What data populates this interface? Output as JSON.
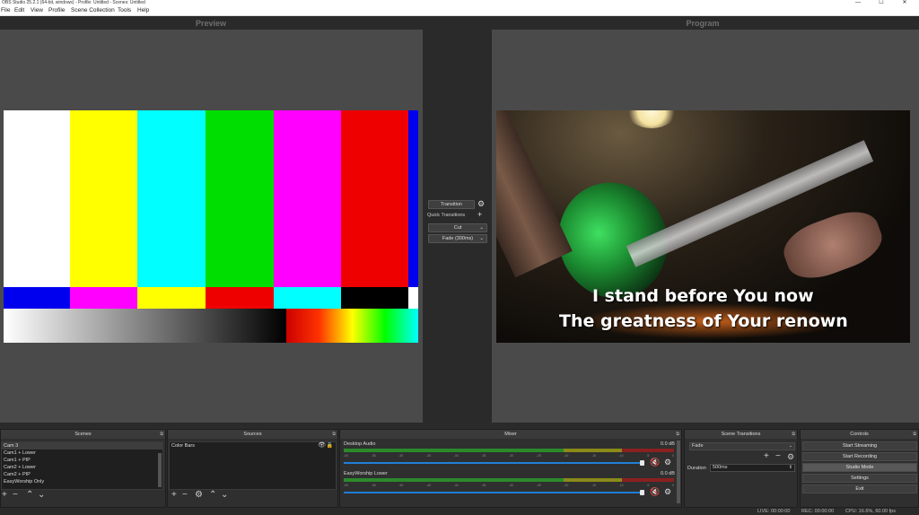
{
  "window": {
    "title": "OBS Studio 25.2.1 (64-bit, windows) - Profile: Untitled - Scenes: Untitled",
    "minimize": "—",
    "maximize": "☐",
    "close": "✕"
  },
  "menu": [
    "File",
    "Edit",
    "View",
    "Profile",
    "Scene Collection",
    "Tools",
    "Help"
  ],
  "preview": {
    "label": "Preview"
  },
  "program": {
    "label": "Program",
    "lyric_line1": "I stand before You now",
    "lyric_line2": "The greatness of Your renown"
  },
  "transition_panel": {
    "transition_button": "Transition",
    "quick_transitions_label": "Quick Transitions",
    "cut_label": "Cut",
    "fade_label": "Fade (300ms)"
  },
  "scenes": {
    "title": "Scenes",
    "items": [
      "Cam 3",
      "Cam1 + Lower",
      "Cam1 + PIP",
      "Cam2 + Lower",
      "Cam2 + PIP",
      "EasyWorship Only"
    ],
    "selected_index": 0
  },
  "sources": {
    "title": "Sources",
    "items": [
      "Color Bars"
    ]
  },
  "mixer": {
    "title": "Mixer",
    "channels": [
      {
        "name": "Desktop Audio",
        "level": "0.0 dB",
        "volume": 0.98,
        "muted": true
      },
      {
        "name": "EasyWorship Lower",
        "level": "0.0 dB",
        "volume": 0.98,
        "muted": true
      }
    ],
    "scale": [
      "-60",
      "-55",
      "-50",
      "-45",
      "-40",
      "-35",
      "-30",
      "-25",
      "-20",
      "-15",
      "-10",
      "-5",
      "0"
    ]
  },
  "scene_transitions": {
    "title": "Scene Transitions",
    "selected": "Fade",
    "duration_label": "Duration",
    "duration_value": "500ms"
  },
  "controls": {
    "title": "Controls",
    "buttons": [
      "Start Streaming",
      "Start Recording",
      "Studio Mode",
      "Settings",
      "Exit"
    ],
    "active_index": 2
  },
  "status": {
    "live": "LIVE: 00:00:00",
    "rec": "REC: 00:00:00",
    "cpu": "CPU: 16.6%, 60.00 fps"
  },
  "colors": {
    "accent": "#1f7fd8",
    "mute": "#d03030"
  }
}
